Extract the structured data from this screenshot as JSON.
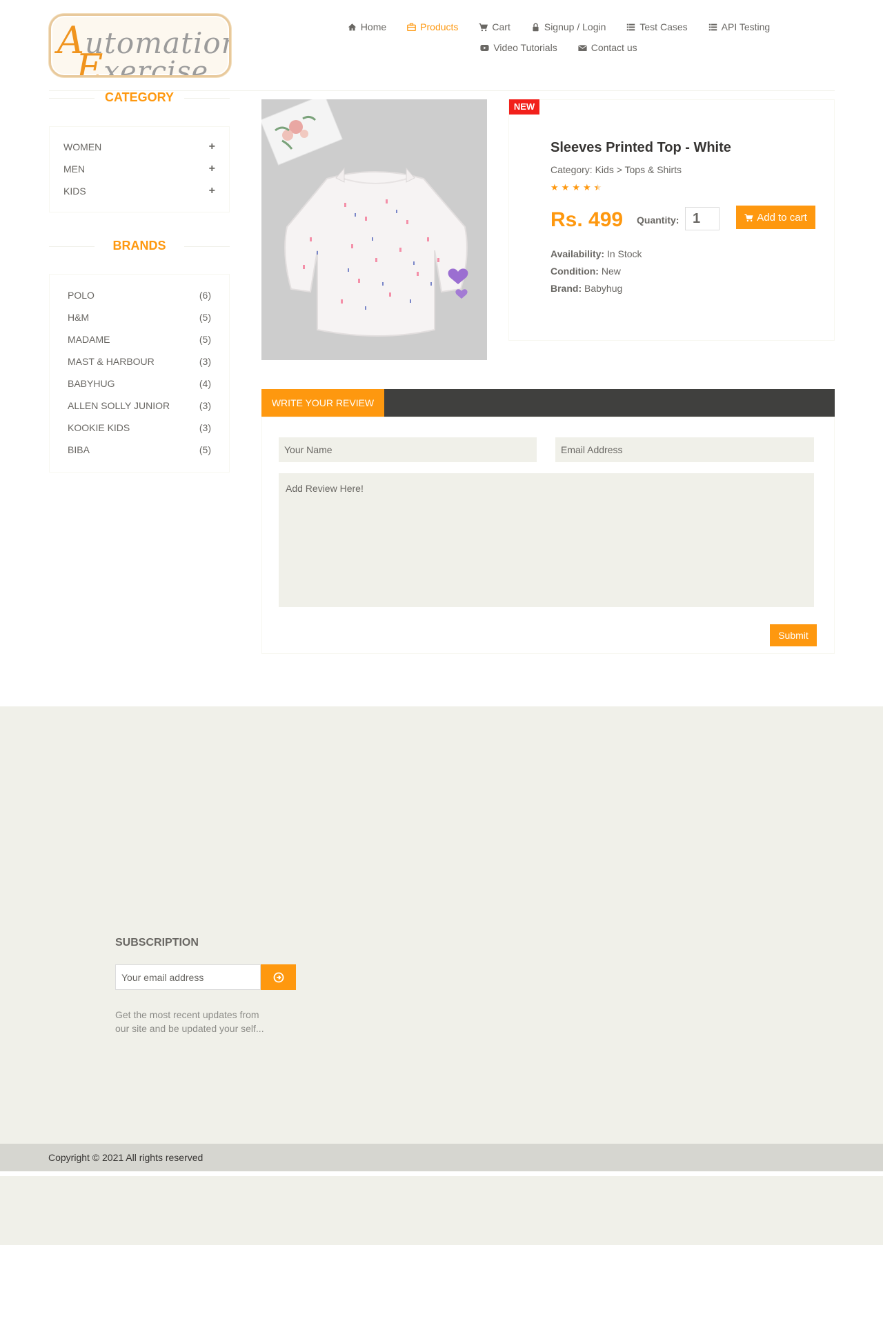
{
  "header": {
    "logo_line1": "Automation",
    "logo_line2": "Exercise",
    "nav": [
      {
        "label": "Home",
        "icon": "home-icon"
      },
      {
        "label": "Products",
        "icon": "briefcase-icon",
        "active": true
      },
      {
        "label": "Cart",
        "icon": "cart-icon"
      },
      {
        "label": "Signup / Login",
        "icon": "lock-icon"
      },
      {
        "label": "Test Cases",
        "icon": "list-icon"
      },
      {
        "label": "API Testing",
        "icon": "list-icon"
      },
      {
        "label": "Video Tutorials",
        "icon": "youtube-play-icon"
      },
      {
        "label": "Contact us",
        "icon": "envelope-icon"
      }
    ]
  },
  "sidebar": {
    "category_title": "CATEGORY",
    "categories": [
      "WOMEN",
      "MEN",
      "KIDS"
    ],
    "brands_title": "BRANDS",
    "brands": [
      {
        "name": "POLO",
        "count": "(6)"
      },
      {
        "name": "H&M",
        "count": "(5)"
      },
      {
        "name": "MADAME",
        "count": "(5)"
      },
      {
        "name": "MAST & HARBOUR",
        "count": "(3)"
      },
      {
        "name": "BABYHUG",
        "count": "(4)"
      },
      {
        "name": "ALLEN SOLLY JUNIOR",
        "count": "(3)"
      },
      {
        "name": "KOOKIE KIDS",
        "count": "(3)"
      },
      {
        "name": "BIBA",
        "count": "(5)"
      }
    ]
  },
  "product": {
    "badge": "NEW",
    "title": "Sleeves Printed Top - White",
    "category": "Category: Kids > Tops & Shirts",
    "rating": 4.5,
    "price": "Rs. 499",
    "quantity_label": "Quantity:",
    "quantity_value": "1",
    "add_to_cart": "Add to cart",
    "availability_label": "Availability:",
    "availability": "In Stock",
    "condition_label": "Condition:",
    "condition": "New",
    "brand_label": "Brand:",
    "brand": "Babyhug"
  },
  "review": {
    "tab": "WRITE YOUR REVIEW",
    "name_placeholder": "Your Name",
    "email_placeholder": "Email Address",
    "review_placeholder": "Add Review Here!",
    "submit": "Submit"
  },
  "footer": {
    "subscription_title": "SUBSCRIPTION",
    "email_placeholder": "Your email address",
    "description": "Get the most recent updates from our site and be updated your self...",
    "copyright": "Copyright © 2021 All rights reserved"
  },
  "colors": {
    "accent": "#fe980f",
    "badge": "#f2201b",
    "dark_bar": "#40403e",
    "footer_bg": "#f0f0e9"
  }
}
